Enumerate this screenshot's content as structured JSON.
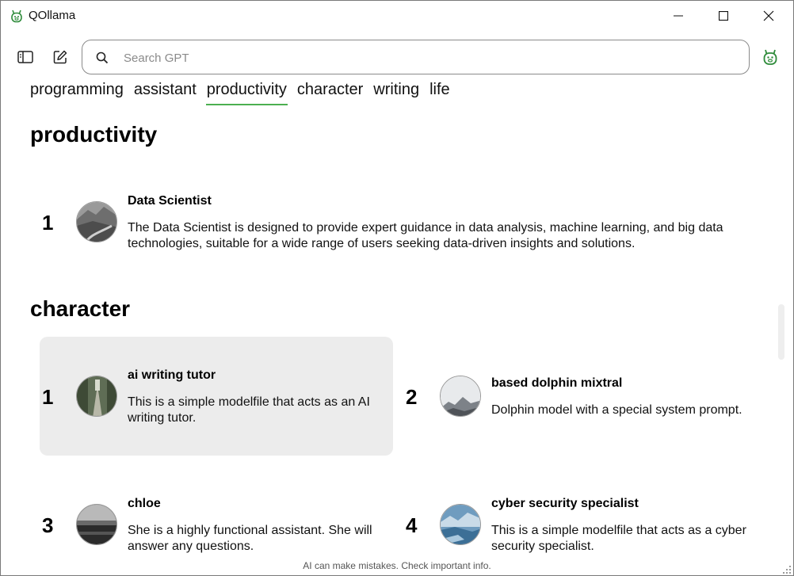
{
  "window": {
    "title": "QOllama"
  },
  "search": {
    "placeholder": "Search GPT"
  },
  "tabs": [
    {
      "label": "programming"
    },
    {
      "label": "assistant"
    },
    {
      "label": "productivity"
    },
    {
      "label": "character"
    },
    {
      "label": "writing"
    },
    {
      "label": "life"
    }
  ],
  "active_tab": "productivity",
  "accent_color": "#4caf50",
  "sections": {
    "productivity": {
      "title": "productivity",
      "items": [
        {
          "rank": "1",
          "name": "Data Scientist",
          "description": "The Data Scientist is designed to provide expert guidance in data analysis, machine learning, and big data technologies, suitable for a wide range of users seeking data-driven insights and solutions.",
          "avatar": "mountain-road-image"
        }
      ]
    },
    "character": {
      "title": "character",
      "items": [
        {
          "rank": "1",
          "name": "ai writing tutor",
          "description": "This is a simple modelfile that acts as an AI writing tutor.",
          "avatar": "forest-road-image"
        },
        {
          "rank": "2",
          "name": "based dolphin mixtral",
          "description": "Dolphin model with a special system prompt.",
          "avatar": "misty-mountain-image"
        },
        {
          "rank": "3",
          "name": "chloe",
          "description": "She is a highly functional assistant. She will answer any questions.",
          "avatar": "dark-sea-image"
        },
        {
          "rank": "4",
          "name": "cyber security specialist",
          "description": "This is a simple modelfile that acts as a cyber security specialist.",
          "avatar": "ice-lake-image"
        }
      ]
    }
  },
  "footer": {
    "notice": "AI can make mistakes. Check important info."
  }
}
